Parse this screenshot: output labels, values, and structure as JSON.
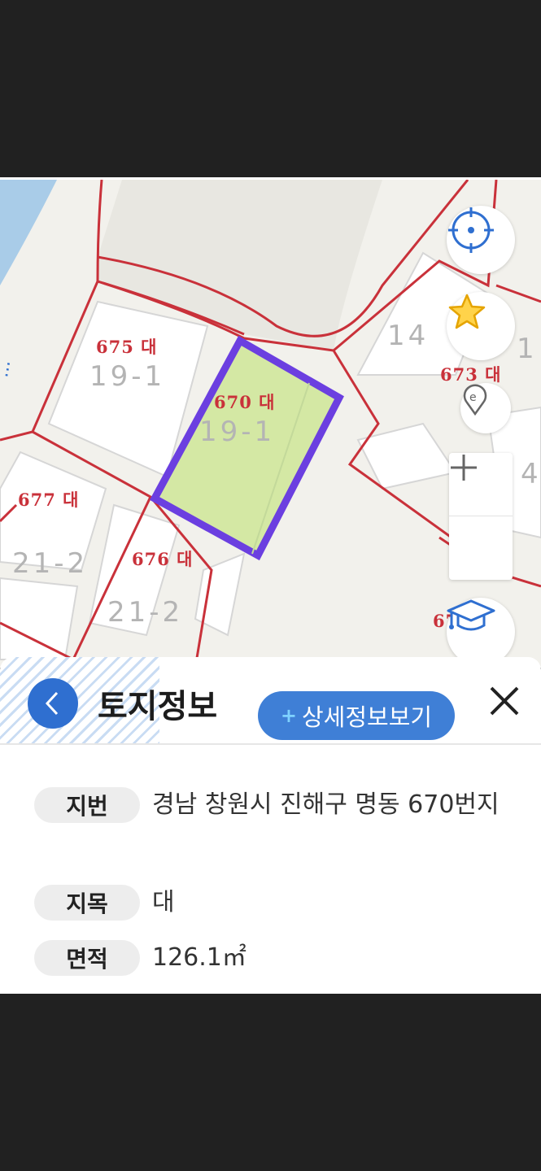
{
  "map": {
    "parcels": [
      {
        "label": "675 대",
        "block": "19-1"
      },
      {
        "label": "670 대",
        "block": "19-1"
      },
      {
        "label": "677 대",
        "block": "21-2"
      },
      {
        "label": "676 대",
        "block": "21-2"
      },
      {
        "label": "673 대",
        "block": "14"
      },
      {
        "label": "67",
        "block": ""
      }
    ],
    "block_extra": [
      "1",
      "4"
    ],
    "selected_parcel_color": "#6b3fe0",
    "selected_fill": "#d4e8a4",
    "boundary_color": "#c9313a",
    "water_color": "#a9cce8"
  },
  "controls": {
    "locate": "crosshair-icon",
    "favorite": "star-icon",
    "marker": "map-pin-icon",
    "zoom_in": "+",
    "zoom_out": "—",
    "education": "graduation-cap-icon"
  },
  "panel": {
    "title": "토지정보",
    "detail_button": "상세정보보기",
    "detail_plus": "+",
    "rows": [
      {
        "label": "지번",
        "value": "경남 창원시 진해구 명동 670번지"
      },
      {
        "label": "지목",
        "value": "대"
      },
      {
        "label": "면적",
        "value": "126.1㎡"
      }
    ]
  }
}
